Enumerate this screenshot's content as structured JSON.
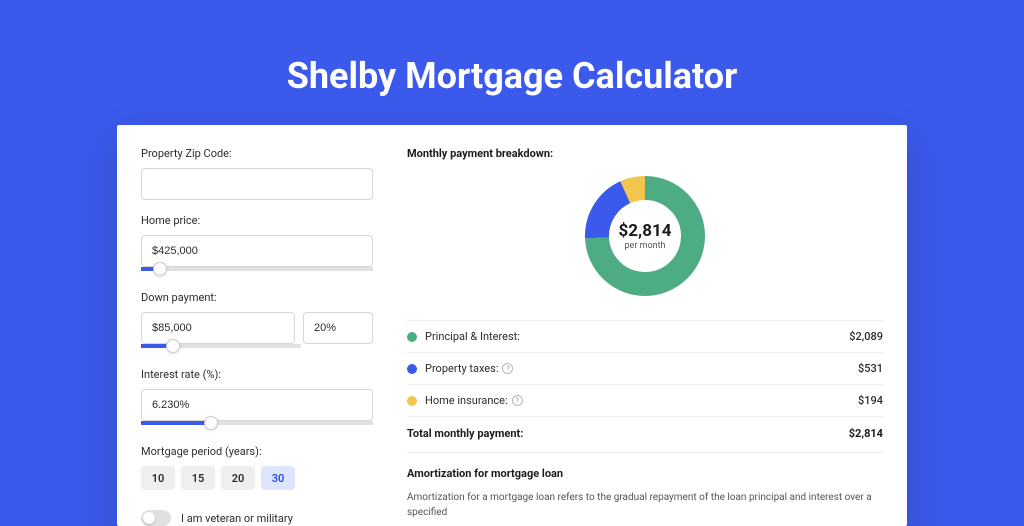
{
  "page_title": "Shelby Mortgage Calculator",
  "form": {
    "zip_label": "Property Zip Code:",
    "zip_value": "",
    "home_price_label": "Home price:",
    "home_price_value": "$425,000",
    "down_payment_label": "Down payment:",
    "down_payment_value": "$85,000",
    "down_payment_pct": "20%",
    "interest_label": "Interest rate (%):",
    "interest_value": "6.230%",
    "period_label": "Mortgage period (years):",
    "period_options": [
      "10",
      "15",
      "20",
      "30"
    ],
    "period_selected": "30",
    "veteran_label": "I am veteran or military",
    "slider_home_pct": 8,
    "slider_down_pct": 20,
    "slider_interest_pct": 30
  },
  "breakdown": {
    "title": "Monthly payment breakdown:",
    "center_amount": "$2,814",
    "center_sub": "per month",
    "items": [
      {
        "label": "Principal & Interest:",
        "amount": "$2,089",
        "color": "#4eac85",
        "help": false
      },
      {
        "label": "Property taxes:",
        "amount": "$531",
        "color": "#3b5aeb",
        "help": true
      },
      {
        "label": "Home insurance:",
        "amount": "$194",
        "color": "#f1c54e",
        "help": true
      }
    ],
    "total_label": "Total monthly payment:",
    "total_amount": "$2,814"
  },
  "amortization": {
    "title": "Amortization for mortgage loan",
    "text": "Amortization for a mortgage loan refers to the gradual repayment of the loan principal and interest over a specified"
  },
  "chart_data": {
    "type": "pie",
    "title": "Monthly payment breakdown",
    "categories": [
      "Principal & Interest",
      "Property taxes",
      "Home insurance"
    ],
    "values": [
      2089,
      531,
      194
    ],
    "colors": [
      "#4eac85",
      "#3b5aeb",
      "#f1c54e"
    ],
    "total": 2814,
    "center_label": "$2,814 per month",
    "donut": true
  }
}
